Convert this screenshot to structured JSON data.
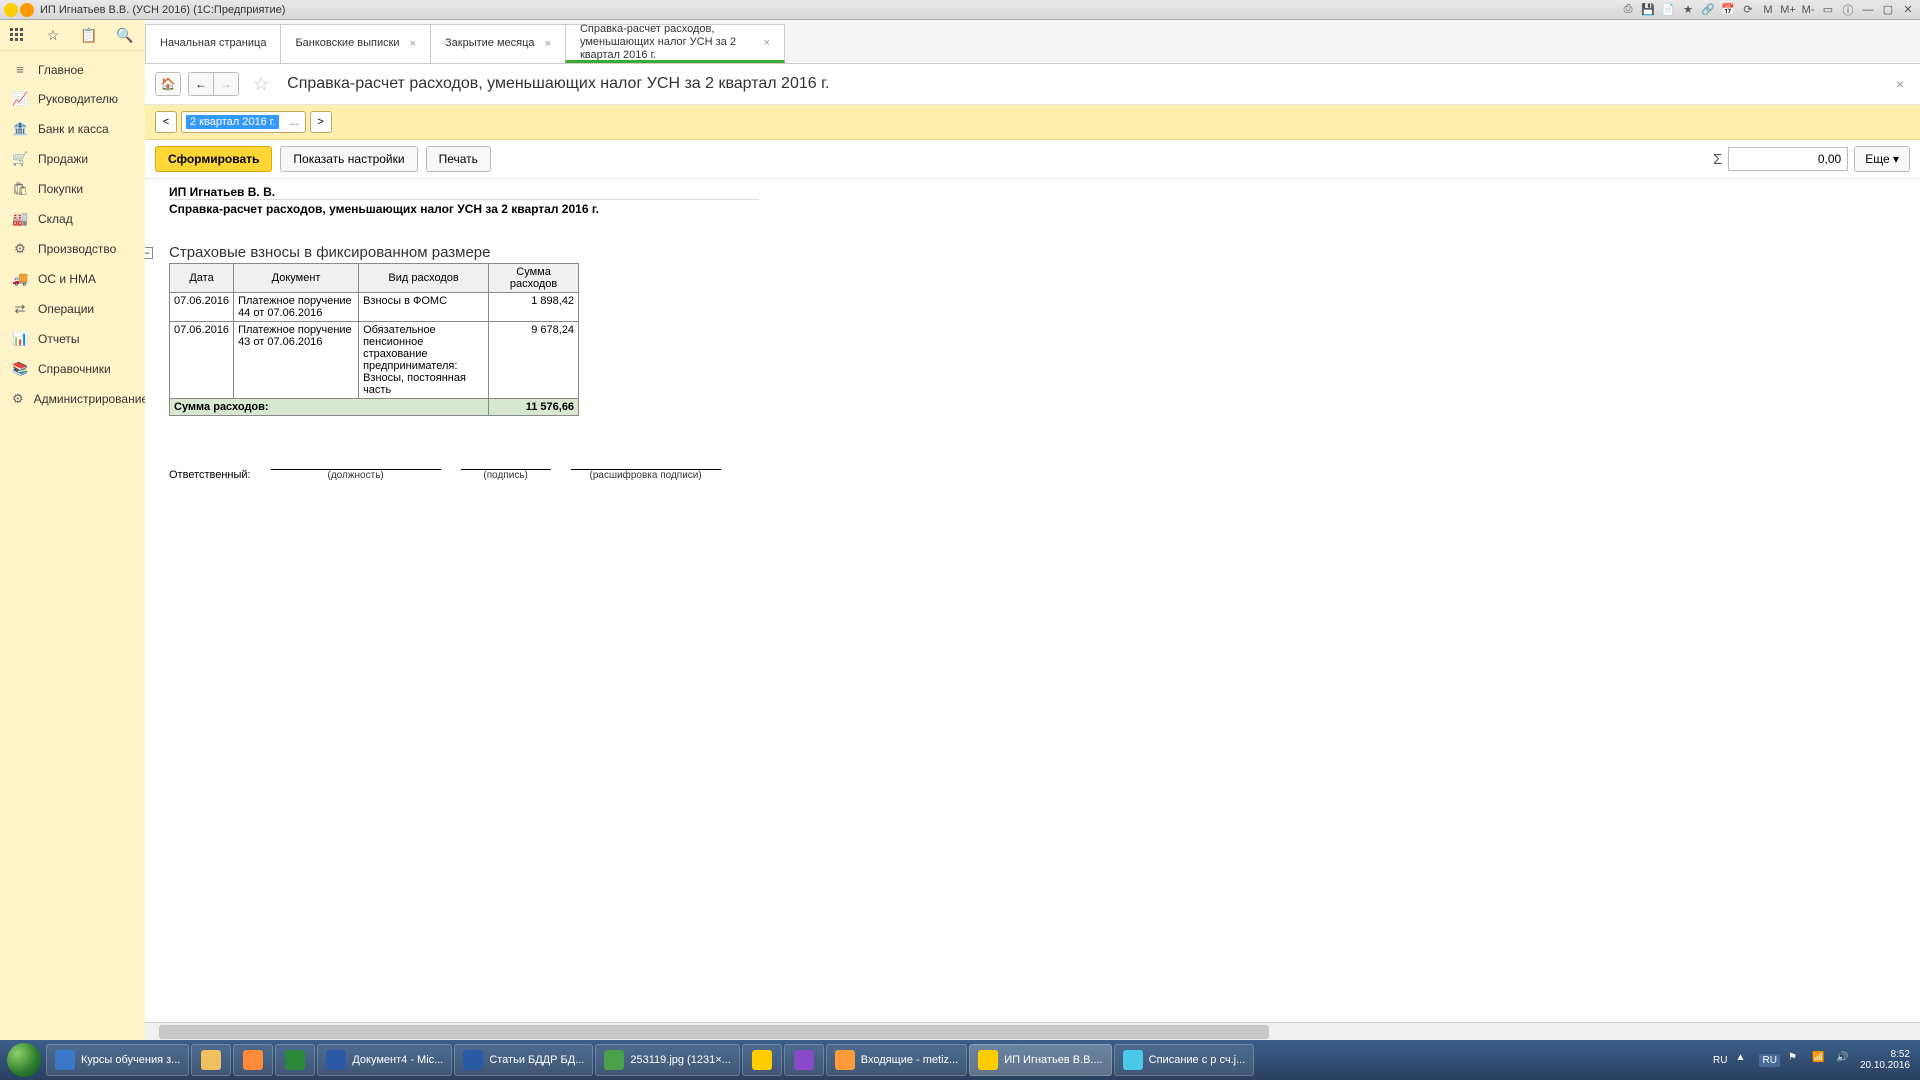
{
  "titlebar": {
    "title": "ИП Игнатьев В.В. (УСН 2016)  (1С:Предприятие)"
  },
  "titlebar_right": {
    "m": "M",
    "mplus": "M+",
    "mminus": "M-"
  },
  "tabs": [
    {
      "label": "Начальная страница",
      "closable": false
    },
    {
      "label": "Банковские выписки",
      "closable": true
    },
    {
      "label": "Закрытие месяца",
      "closable": true
    },
    {
      "label": "Справка-расчет расходов, уменьшающих налог УСН  за 2 квартал 2016 г.",
      "closable": true,
      "active": true
    }
  ],
  "nav": [
    {
      "icon": "menu",
      "label": "Главное"
    },
    {
      "icon": "trend",
      "label": "Руководителю"
    },
    {
      "icon": "bank",
      "label": "Банк и касса"
    },
    {
      "icon": "cart",
      "label": "Продажи"
    },
    {
      "icon": "basket",
      "label": "Покупки"
    },
    {
      "icon": "warehouse",
      "label": "Склад"
    },
    {
      "icon": "factory",
      "label": "Производство"
    },
    {
      "icon": "truck",
      "label": "ОС и НМА"
    },
    {
      "icon": "ops",
      "label": "Операции"
    },
    {
      "icon": "chart",
      "label": "Отчеты"
    },
    {
      "icon": "book",
      "label": "Справочники"
    },
    {
      "icon": "gear",
      "label": "Администрирование"
    }
  ],
  "page": {
    "title": "Справка-расчет расходов, уменьшающих налог УСН  за 2 квартал 2016 г.",
    "period": "2 квартал 2016 г.",
    "prev": "<",
    "next": ">",
    "generate": "Сформировать",
    "show_settings": "Показать настройки",
    "print": "Печать",
    "sum_value": "0,00",
    "more": "Еще ▾"
  },
  "report": {
    "org": "ИП Игнатьев В. В.",
    "title": "Справка-расчет расходов, уменьшающих налог УСН  за 2 квартал 2016 г.",
    "section": "Страховые взносы в фиксированном размере",
    "columns": [
      "Дата",
      "Документ",
      "Вид расходов",
      "Сумма расходов"
    ],
    "rows": [
      {
        "date": "07.06.2016",
        "doc": "Платежное поручение 44 от 07.06.2016",
        "type": "Взносы в ФОМС",
        "sum": "1 898,42"
      },
      {
        "date": "07.06.2016",
        "doc": "Платежное поручение 43 от 07.06.2016",
        "type": "Обязательное пенсионное страхование предпринимателя: Взносы, постоянная часть",
        "sum": "9 678,24"
      }
    ],
    "total_label": "Сумма расходов:",
    "total_value": "11 576,66",
    "responsible": "Ответственный:",
    "sign1": "(должность)",
    "sign2": "(подпись)",
    "sign3": "(расшифровка подписи)"
  },
  "taskbar": {
    "items": [
      {
        "label": "Курсы обучения з...",
        "color": "#3a77c8"
      },
      {
        "label": "",
        "color": "#f0c060",
        "icon_only": true
      },
      {
        "label": "",
        "color": "#ff8a3a",
        "icon_only": true
      },
      {
        "label": "",
        "color": "#2a8a3a",
        "icon_only": true
      },
      {
        "label": "Документ4 - Mic...",
        "color": "#2a5aa8"
      },
      {
        "label": "Статьи БДДР БД...",
        "color": "#2a5aa8"
      },
      {
        "label": "253119.jpg (1231×...",
        "color": "#4aa04a"
      },
      {
        "label": "",
        "color": "#ffcc00",
        "icon_only": true
      },
      {
        "label": "",
        "color": "#8a4ac8",
        "icon_only": true
      },
      {
        "label": "Входящие - metiz...",
        "color": "#ff9a3a"
      },
      {
        "label": "ИП Игнатьев В.В....",
        "color": "#ffcc00",
        "active": true
      },
      {
        "label": "Списание с р сч.j...",
        "color": "#4ac8e8"
      }
    ],
    "lang": "RU",
    "lang2": "RU",
    "time": "8:52",
    "date": "20.10.2016"
  }
}
